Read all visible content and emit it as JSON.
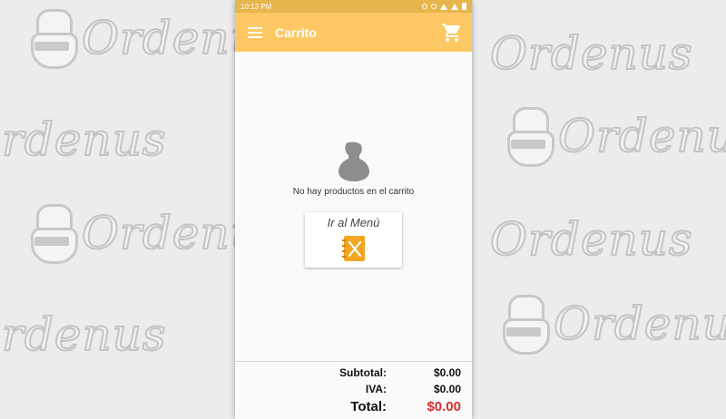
{
  "status_bar": {
    "time": "10:13 PM"
  },
  "app_bar": {
    "title": "Carrito"
  },
  "empty_state": {
    "message": "No hay productos en el carrito"
  },
  "menu_button": {
    "label": "Ir al Menú"
  },
  "totals": {
    "subtotal_label": "Subtotal:",
    "subtotal_value": "$0.00",
    "iva_label": "IVA:",
    "iva_value": "$0.00",
    "total_label": "Total:",
    "total_value": "$0.00"
  },
  "watermark": {
    "word": "Ordenus"
  },
  "colors": {
    "app_bar": "#fdc863",
    "status_bar": "#e6b54b",
    "total_red": "#d32f2f",
    "menu_icon_orange": "#f4a623"
  },
  "icons": [
    "menu-icon",
    "cart-icon",
    "chef-icon",
    "menu-book-icon"
  ]
}
